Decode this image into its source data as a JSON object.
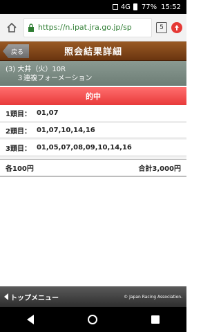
{
  "status": {
    "signal": "4G",
    "battery": "77%",
    "time": "15:52"
  },
  "browser": {
    "url": "https://n.ipat.jra.go.jp/sp",
    "tab_count": "5"
  },
  "header": {
    "back_label": "戻る",
    "title": "照会結果詳細"
  },
  "race": {
    "line1": "(3) 大井（火）10R",
    "line2": "３連複フォーメーション"
  },
  "result_label": "的中",
  "selections": [
    {
      "label": "1頭目：",
      "value": "01,07"
    },
    {
      "label": "2頭目：",
      "value": "01,07,10,14,16"
    },
    {
      "label": "3頭目：",
      "value": "01,05,07,08,09,10,14,16"
    }
  ],
  "summary": {
    "unit": "各100円",
    "total": "合計3,000円"
  },
  "footer": {
    "top_menu": "トップメニュー",
    "copyright": "© Japan Racing Association."
  },
  "colors": {
    "header": "#7a4216",
    "race_info": "#7d8d85",
    "hit": "#f05050",
    "url": "#2e7d32"
  }
}
